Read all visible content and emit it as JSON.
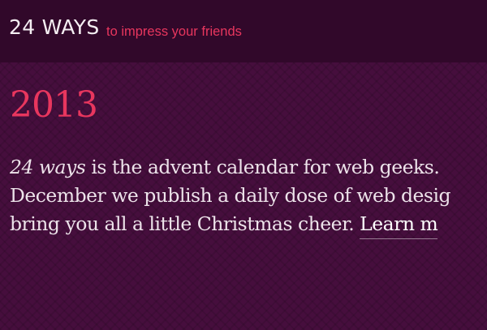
{
  "header": {
    "site_name": "24 WAYS",
    "tagline": "to impress your friends"
  },
  "main": {
    "year": "2013",
    "intro": {
      "line1_em": "24 ways",
      "line1_rest": " is the advent calendar for web geeks.",
      "line2": "December we publish a daily dose of web desig",
      "line3_text": "bring you all a little Christmas cheer. ",
      "learn_more_label": "Learn m"
    }
  },
  "colors": {
    "accent": "#e8365e",
    "masthead_bg": "#31082a",
    "page_bg": "#460e3d",
    "body_text": "#ede3ea"
  }
}
